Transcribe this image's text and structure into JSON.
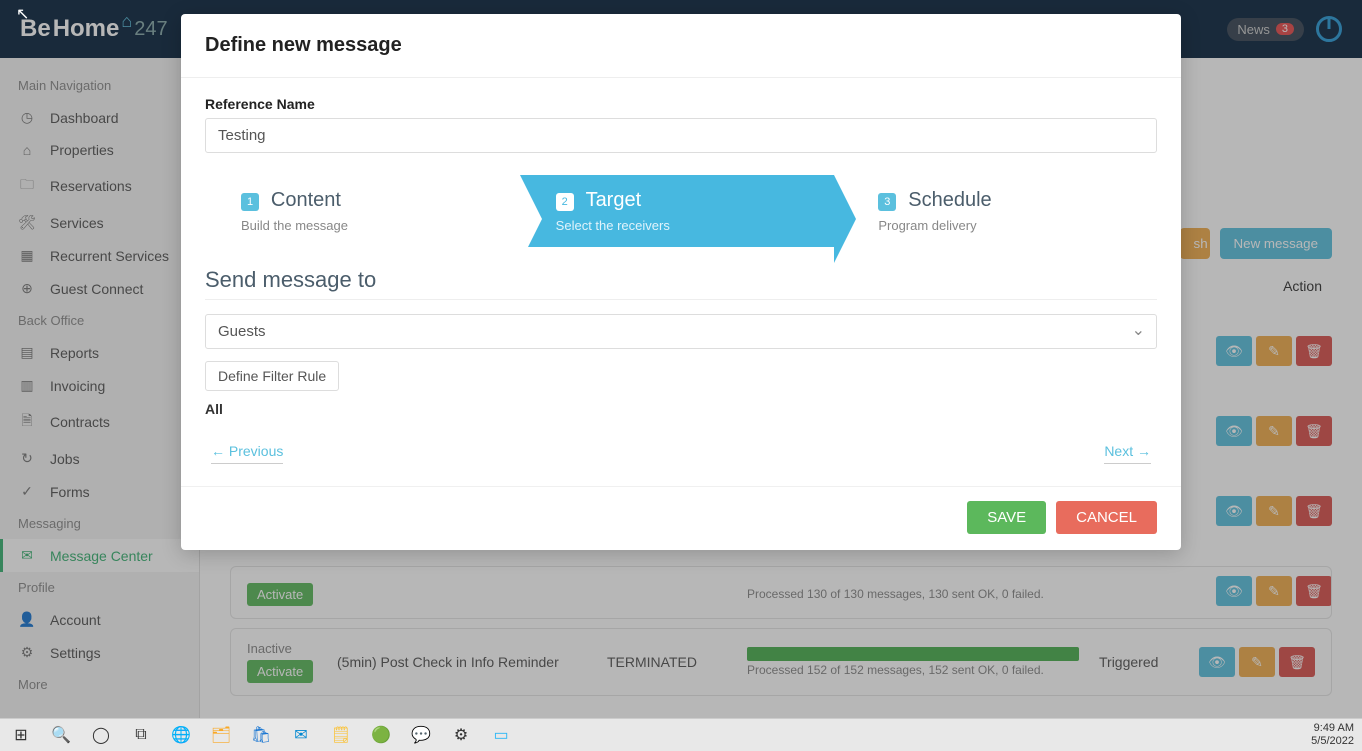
{
  "brand": {
    "part1": "Be",
    "part2": "Home",
    "part3": "247"
  },
  "topnav": {
    "news_label": "News",
    "news_count": "3"
  },
  "sidebar": {
    "sections": {
      "main": "Main Navigation",
      "back": "Back Office",
      "msg": "Messaging",
      "profile": "Profile",
      "more": "More"
    },
    "items": {
      "dashboard": "Dashboard",
      "properties": "Properties",
      "reservations": "Reservations",
      "services": "Services",
      "recurrent": "Recurrent Services",
      "guest": "Guest Connect",
      "reports": "Reports",
      "invoicing": "Invoicing",
      "contracts": "Contracts",
      "jobs": "Jobs",
      "forms": "Forms",
      "message_center": "Message Center",
      "account": "Account",
      "settings": "Settings"
    }
  },
  "main": {
    "new_message": "New message",
    "action_header": "Action",
    "rows": [
      {
        "status": "Inactive",
        "activate": "Activate",
        "title": "(5min) Post Check in Info Reminder",
        "state": "TERMINATED",
        "progress_text": "Processed 152 of 152 messages, 152 sent OK, 0 failed.",
        "trigger": "Triggered"
      },
      {
        "status": "",
        "activate": "Activate",
        "title": "",
        "state": "",
        "progress_text": "Processed 130 of 130 messages, 130 sent OK, 0 failed.",
        "trigger": ""
      }
    ]
  },
  "modal": {
    "title": "Define new message",
    "ref_label": "Reference Name",
    "ref_value": "Testing",
    "steps": [
      {
        "num": "1",
        "title": "Content",
        "desc": "Build the message"
      },
      {
        "num": "2",
        "title": "Target",
        "desc": "Select the receivers"
      },
      {
        "num": "3",
        "title": "Schedule",
        "desc": "Program delivery"
      }
    ],
    "section_title": "Send message to",
    "recipient_select": "Guests",
    "filter_btn": "Define Filter Rule",
    "all_label": "All",
    "prev": "← Previous",
    "next": "Next →",
    "save": "SAVE",
    "cancel": "CANCEL"
  },
  "taskbar": {
    "time": "9:49 AM",
    "date": "5/5/2022"
  }
}
